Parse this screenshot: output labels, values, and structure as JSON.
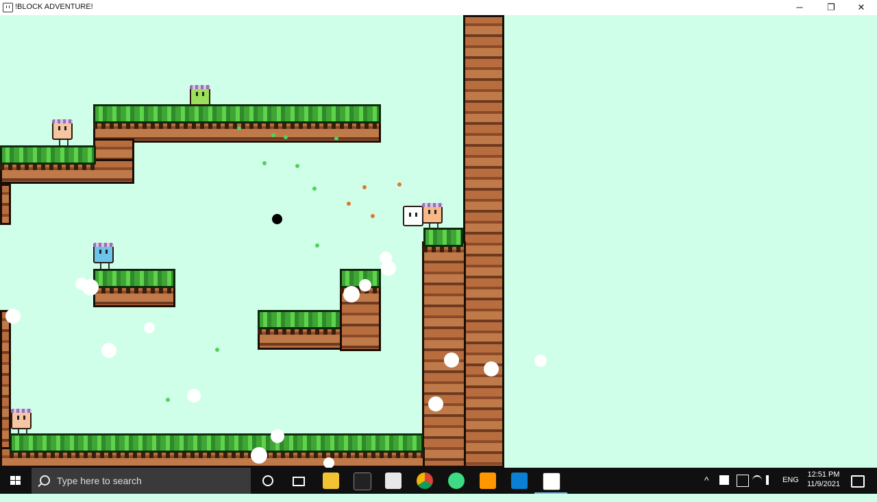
{
  "window": {
    "title": "!BLOCK ADVENTURE!",
    "controls": [
      "─",
      "❐",
      "✕"
    ]
  },
  "taskbar": {
    "search_placeholder": "Type here to search",
    "apps": [
      "task-view",
      "file-explorer",
      "terminal",
      "pixel-app",
      "chrome",
      "android-studio",
      "sublime-text",
      "vscode",
      "block-adventure"
    ],
    "tray": {
      "language": "ENG",
      "time": "12:51 PM",
      "date": "11/9/2021"
    }
  }
}
